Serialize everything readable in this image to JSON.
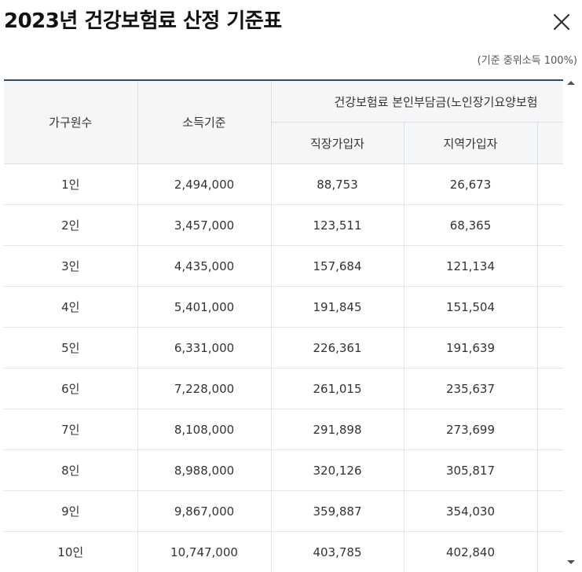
{
  "header": {
    "title": "2023년 건강보험료 산정 기준표",
    "close_icon": "close-icon"
  },
  "note": "(기준 중위소득 100%)",
  "table": {
    "col_household": "가구원수",
    "col_income": "소득기준",
    "col_group": "건강보험료 본인부담금(노인장기요양보험",
    "col_employee": "직장가입자",
    "col_regional": "지역가입자",
    "rows": [
      {
        "household": "1인",
        "income": "2,494,000",
        "employee": "88,753",
        "regional": "26,673"
      },
      {
        "household": "2인",
        "income": "3,457,000",
        "employee": "123,511",
        "regional": "68,365"
      },
      {
        "household": "3인",
        "income": "4,435,000",
        "employee": "157,684",
        "regional": "121,134"
      },
      {
        "household": "4인",
        "income": "5,401,000",
        "employee": "191,845",
        "regional": "151,504"
      },
      {
        "household": "5인",
        "income": "6,331,000",
        "employee": "226,361",
        "regional": "191,639"
      },
      {
        "household": "6인",
        "income": "7,228,000",
        "employee": "261,015",
        "regional": "235,637"
      },
      {
        "household": "7인",
        "income": "8,108,000",
        "employee": "291,898",
        "regional": "273,699"
      },
      {
        "household": "8인",
        "income": "8,988,000",
        "employee": "320,126",
        "regional": "305,817"
      },
      {
        "household": "9인",
        "income": "9,867,000",
        "employee": "359,887",
        "regional": "354,030"
      },
      {
        "household": "10인",
        "income": "10,747,000",
        "employee": "403,785",
        "regional": "402,840"
      }
    ]
  },
  "colors": {
    "header_bg": "#f5f6f8",
    "top_border": "#34495e",
    "grid": "#e3e5e8"
  }
}
